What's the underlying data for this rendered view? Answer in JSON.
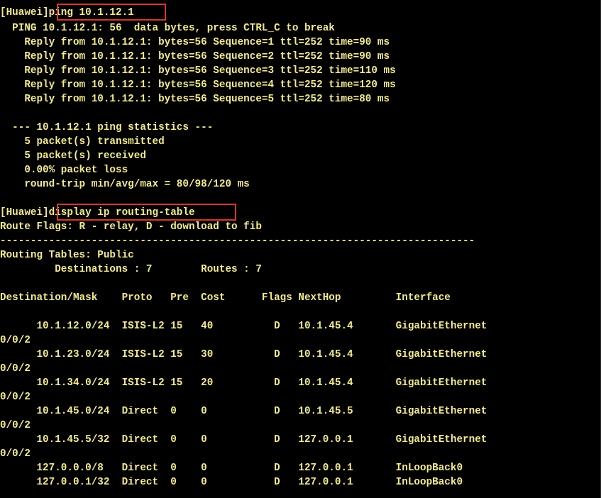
{
  "colors": {
    "background": "#000000",
    "text": "#f2ea8e",
    "highlight_box": "#d9362b"
  },
  "lines": [
    {
      "id": "prompt-ping",
      "text": "[Huawei]ping 10.1.12.1"
    },
    {
      "id": "ping-header",
      "text": "  PING 10.1.12.1: 56  data bytes, press CTRL_C to break"
    },
    {
      "id": "reply-1",
      "text": "    Reply from 10.1.12.1: bytes=56 Sequence=1 ttl=252 time=90 ms"
    },
    {
      "id": "reply-2",
      "text": "    Reply from 10.1.12.1: bytes=56 Sequence=2 ttl=252 time=90 ms"
    },
    {
      "id": "reply-3",
      "text": "    Reply from 10.1.12.1: bytes=56 Sequence=3 ttl=252 time=110 ms"
    },
    {
      "id": "reply-4",
      "text": "    Reply from 10.1.12.1: bytes=56 Sequence=4 ttl=252 time=120 ms"
    },
    {
      "id": "reply-5",
      "text": "    Reply from 10.1.12.1: bytes=56 Sequence=5 ttl=252 time=80 ms"
    },
    {
      "id": "blank-1",
      "text": ""
    },
    {
      "id": "stats-title",
      "text": "  --- 10.1.12.1 ping statistics ---"
    },
    {
      "id": "stats-transmitted",
      "text": "    5 packet(s) transmitted"
    },
    {
      "id": "stats-received",
      "text": "    5 packet(s) received"
    },
    {
      "id": "stats-loss",
      "text": "    0.00% packet loss"
    },
    {
      "id": "stats-rtt",
      "text": "    round-trip min/avg/max = 80/98/120 ms"
    },
    {
      "id": "blank-2",
      "text": ""
    },
    {
      "id": "prompt-display",
      "text": "[Huawei]display ip routing-table"
    },
    {
      "id": "route-flags",
      "text": "Route Flags: R - relay, D - download to fib"
    },
    {
      "id": "separator",
      "text": "------------------------------------------------------------------------------"
    },
    {
      "id": "routing-tables",
      "text": "Routing Tables: Public"
    },
    {
      "id": "destinations-routes",
      "text": "         Destinations : 7        Routes : 7"
    },
    {
      "id": "blank-3",
      "text": ""
    },
    {
      "id": "table-header",
      "text": "Destination/Mask    Proto   Pre  Cost      Flags NextHop         Interface"
    },
    {
      "id": "blank-4",
      "text": ""
    },
    {
      "id": "route-1",
      "text": "      10.1.12.0/24  ISIS-L2 15   40          D   10.1.45.4       GigabitEthernet"
    },
    {
      "id": "route-1-cont",
      "text": "0/0/2"
    },
    {
      "id": "route-2",
      "text": "      10.1.23.0/24  ISIS-L2 15   30          D   10.1.45.4       GigabitEthernet"
    },
    {
      "id": "route-2-cont",
      "text": "0/0/2"
    },
    {
      "id": "route-3",
      "text": "      10.1.34.0/24  ISIS-L2 15   20          D   10.1.45.4       GigabitEthernet"
    },
    {
      "id": "route-3-cont",
      "text": "0/0/2"
    },
    {
      "id": "route-4",
      "text": "      10.1.45.0/24  Direct  0    0           D   10.1.45.5       GigabitEthernet"
    },
    {
      "id": "route-4-cont",
      "text": "0/0/2"
    },
    {
      "id": "route-5",
      "text": "      10.1.45.5/32  Direct  0    0           D   127.0.0.1       GigabitEthernet"
    },
    {
      "id": "route-5-cont",
      "text": "0/0/2"
    },
    {
      "id": "route-6",
      "text": "      127.0.0.0/8   Direct  0    0           D   127.0.0.1       InLoopBack0"
    },
    {
      "id": "route-7",
      "text": "      127.0.0.1/32  Direct  0    0           D   127.0.0.1       InLoopBack0"
    }
  ]
}
